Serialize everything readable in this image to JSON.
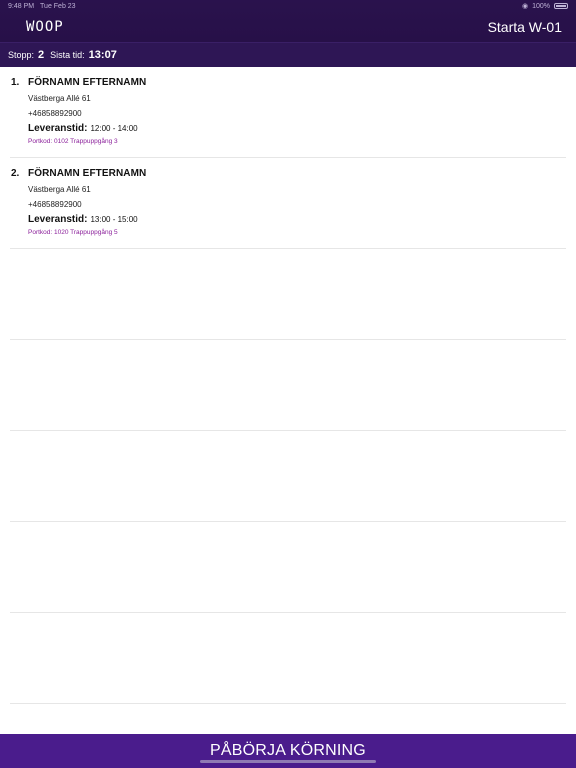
{
  "status_bar": {
    "time": "9:48 PM",
    "date": "Tue Feb 23",
    "battery": "100%",
    "wifi_icon": "wifi-icon"
  },
  "header": {
    "logo": "WOOP",
    "action_label": "Starta W-01"
  },
  "info": {
    "stops_label": "Stopp:",
    "stops_value": "2",
    "last_time_label": "Sista tid:",
    "last_time_value": "13:07"
  },
  "stops": [
    {
      "number": "1.",
      "name": "FÖRNAMN EFTERNAMN",
      "address": "Västberga Allé 61",
      "phone": "+46858892900",
      "delivery_label": "Leveranstid:",
      "delivery_time": "12:00 - 14:00",
      "portcode": "Portkod: 0102 Trappuppgång 3"
    },
    {
      "number": "2.",
      "name": "FÖRNAMN EFTERNAMN",
      "address": "Västberga Allé 61",
      "phone": "+46858892900",
      "delivery_label": "Leveranstid:",
      "delivery_time": "13:00 - 15:00",
      "portcode": "Portkod: 1020 Trappuppgång 5"
    }
  ],
  "footer": {
    "button_label": "PÅBÖRJA KÖRNING"
  },
  "colors": {
    "header_bg": "#2a124d",
    "button_bg": "#4a1c8c",
    "portcode_text": "#8a1f9a"
  }
}
